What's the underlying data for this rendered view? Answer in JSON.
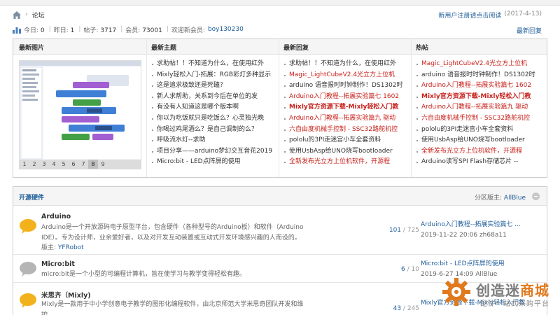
{
  "breadcrumb": {
    "sep": "›",
    "current": "论坛"
  },
  "notice": {
    "text": "新用户注册请点击阅读",
    "date": "(2017-4-13)"
  },
  "stats": {
    "today_label": "今日:",
    "today": "0",
    "yesterday_label": "昨日:",
    "yesterday": "1",
    "posts_label": "帖子:",
    "posts": "3717",
    "members_label": "会员:",
    "members": "73001",
    "welcome_label": "欢迎新会员:",
    "new_member": "boy130230",
    "latest_reply": "最新回复",
    "divider": "|"
  },
  "columns": {
    "images": "最新图片",
    "new_threads": "最新主题",
    "new_replies": "最新回复",
    "hot": "热帖"
  },
  "slideshow": {
    "pages": [
      "1",
      "2",
      "3",
      "4",
      "5",
      "6",
      "7",
      "8",
      "9"
    ],
    "active_index": 7
  },
  "new_threads": [
    {
      "title": "求助帖！！不知道为什么，在使用红外",
      "style": "dark"
    },
    {
      "title": "Mixly轻松入门-拓展：RGB彩灯多种显示",
      "style": "dark"
    },
    {
      "title": "这是追求极致还是死磕?",
      "style": "dark"
    },
    {
      "title": "新人求帮助，关系到今后在单位的发",
      "style": "dark"
    },
    {
      "title": "有没有人知道这是哪个版本啊",
      "style": "dark"
    },
    {
      "title": "你以为吃饭就只是吃饭么？心灵独光晚",
      "style": "dark"
    },
    {
      "title": "你喝过鸡尾酒么？是自己调制的么？",
      "style": "dark"
    },
    {
      "title": "呼吸流水灯--求助",
      "style": "dark"
    },
    {
      "title": "项目分享——arduino梦幻交互音花2019",
      "style": "dark"
    },
    {
      "title": "Micro:bit - LED点阵屏的使用",
      "style": "dark"
    }
  ],
  "new_replies": [
    {
      "title": "求助帖！！不知道为什么，在使用红外",
      "style": "dark"
    },
    {
      "title": "Magic_LightCubeV2.4光立方上位机",
      "style": "red"
    },
    {
      "title": "arduino 语音报时时钟制作！DS1302时",
      "style": "dark"
    },
    {
      "title": "Arduino入门教程--拓展实验篇七 1602",
      "style": "red"
    },
    {
      "title": "Mixly官方资源下载-Mixly轻松入门教",
      "style": "redbold"
    },
    {
      "title": "Arduino入门教程--拓展实验篇九 驱动",
      "style": "red"
    },
    {
      "title": "六自由度机械手控制 - SSC32路舵机控",
      "style": "red"
    },
    {
      "title": "pololu的3PI走迷宫小车全套资料",
      "style": "dark"
    },
    {
      "title": "使用UsbAsp给UNO烧写bootloader",
      "style": "dark"
    },
    {
      "title": "全新发布光立方上位机软件，开源程",
      "style": "red"
    }
  ],
  "hot": [
    {
      "title": "Magic_LightCubeV2.4光立方上位机",
      "style": "red"
    },
    {
      "title": "arduino 语音报时时钟制作！DS1302时",
      "style": "dark"
    },
    {
      "title": "Arduino入门教程--拓展实验篇七 1602",
      "style": "red"
    },
    {
      "title": "Mixly官方资源下载-Mixly轻松入门教",
      "style": "redbold"
    },
    {
      "title": "Arduino入门教程--拓展实验篇九 驱动",
      "style": "red"
    },
    {
      "title": "六自由度机械手控制 - SSC32路舵机控",
      "style": "red"
    },
    {
      "title": "pololu的3PI走迷宫小车全套资料",
      "style": "dark"
    },
    {
      "title": "使用UsbAsp给UNO烧写bootloader",
      "style": "dark"
    },
    {
      "title": "全新发布光立方上位机软件，开源程",
      "style": "red"
    },
    {
      "title": "Arduino读写SPI Flash存储芯片 --",
      "style": "dark"
    }
  ],
  "forum": {
    "title": "开源硬件",
    "moderator_label": "分区版主:",
    "moderator": "AllBlue",
    "boards": [
      {
        "name": "Arduino",
        "desc": "Arduino是一个开放源码电子原型平台，包含硬件（各种型号的Arduino板）和软件（Arduino IDE）。专为设计师，业余爱好者，以及对开发互动装置或互动式开发环境感兴趣的人而设的。",
        "mod_label": "版主:",
        "mod": "YFRobot",
        "threads": "101",
        "posts": "725",
        "last_title": "Arduino入门教程--拓展实验篇七 ...",
        "last_meta": "2019-11-22 20:06 zh68a11",
        "icon_color": "#f2b21b"
      },
      {
        "name": "Micro:bit",
        "desc": "micro:bit是一个小型的可编程计算机，旨在使学习与教学变得轻松有趣。",
        "threads": "6",
        "posts": "10",
        "last_title": "Micro:bit - LED点阵屏的使用",
        "last_meta": "2019-6-27 14:09 AllBlue",
        "icon_color": "#b5b5b5"
      },
      {
        "name": "米思齐（Mixly)",
        "desc": "Mixly是一款用于中小学创意电子教学的图形化编程软件，由北京师范大学米思奇团队开发和维护。",
        "threads": "43",
        "posts": "245",
        "last_title": "Mixly官方资源下载-Mixly轻松入门教...",
        "icon_color": "#f2b21b"
      }
    ],
    "slash": " / "
  },
  "watermark": {
    "brand_a": "创造迷",
    "brand_b": "商城",
    "sub": "配件一站式采购平台"
  }
}
